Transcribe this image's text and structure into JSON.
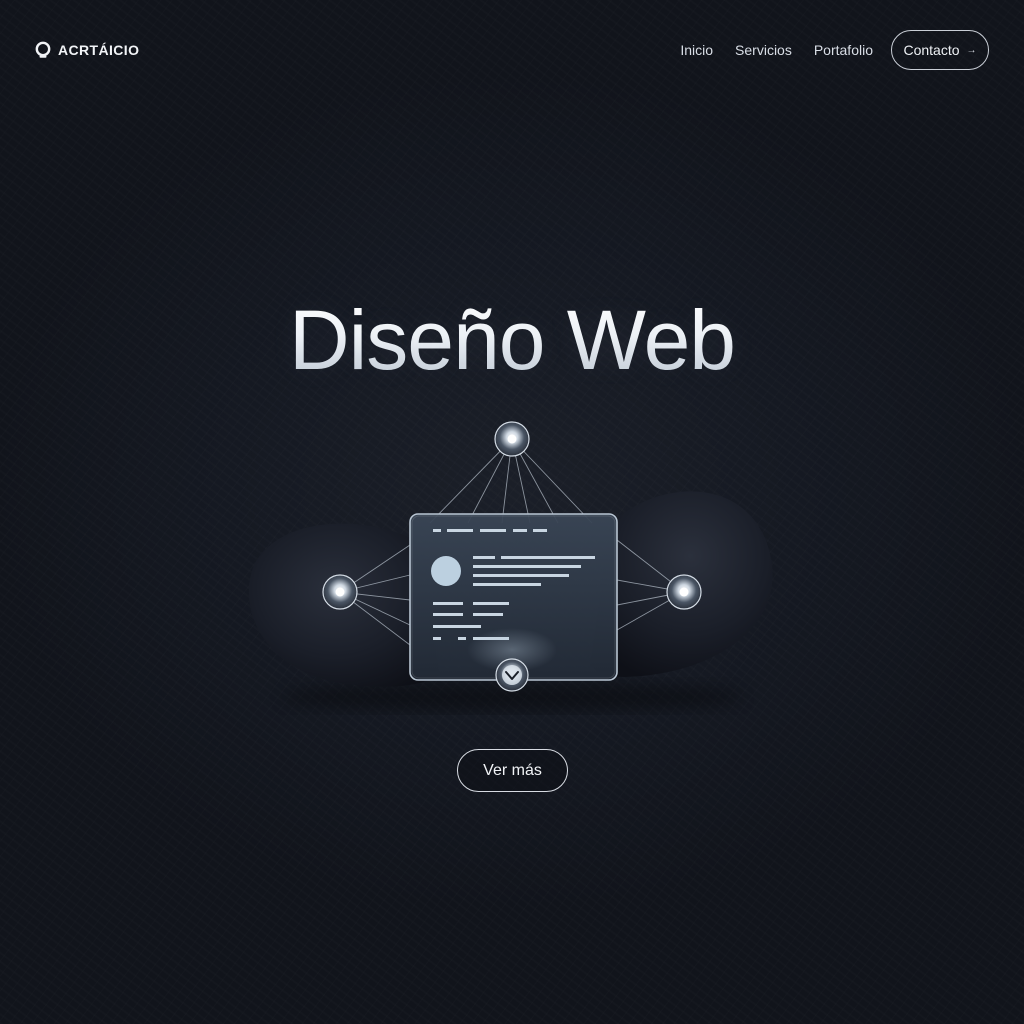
{
  "header": {
    "brand": {
      "name": "ACRTÁICIO",
      "icon": "ring-logo-icon"
    },
    "nav": [
      {
        "label": "Inicio"
      },
      {
        "label": "Servicios"
      },
      {
        "label": "Portafolio"
      }
    ],
    "contact_button": {
      "label": "Contacto",
      "icon": "arrow-right-icon",
      "arrow_glyph": "→"
    }
  },
  "hero": {
    "title": "Diseño Web",
    "illustration": {
      "description_icon": "web-design-network-icon",
      "nodes": [
        "top-node",
        "left-node",
        "right-node",
        "bottom-chevron-node"
      ],
      "window_icon": "browser-window-icon"
    },
    "cta": {
      "label": "Ver más"
    }
  },
  "colors": {
    "background": "#151922",
    "text": "#e8ecf2",
    "panel_glass": "#8ea3b8",
    "accent_light": "#b9cbdc",
    "blob": "#1a1e28"
  }
}
